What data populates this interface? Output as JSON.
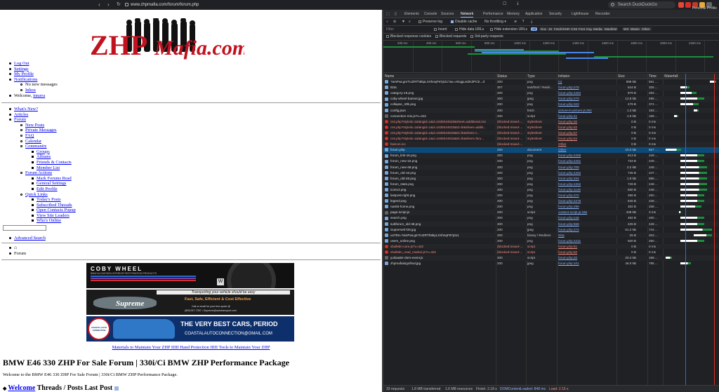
{
  "browser": {
    "url": "www.zhpmafia.com/forum/forum.php",
    "search_placeholder": "Search DuckDuckGo",
    "profile_label": "Personal Profile",
    "badges": [
      "9",
      "289",
      "17"
    ]
  },
  "page": {
    "logo_text_1": "ZHP",
    "logo_text_2": "Mafia.com",
    "user_menu": {
      "log_out": "Log Out",
      "settings": "Settings",
      "my_profile": "My Profile",
      "notifications": "Notifications",
      "no_new_messages": "No new messages",
      "inbox": "Inbox",
      "welcome_prefix": "Welcome, ",
      "username": "innava"
    },
    "nav": {
      "whats_new": "What's New?",
      "articles": "Articles",
      "forum": "Forum",
      "new_posts": "New Posts",
      "private_messages": "Private Messages",
      "faq": "FAQ",
      "calendar": "Calendar",
      "community": "Community",
      "groups": "Groups",
      "albums": "Albums",
      "friends_contacts": "Friends & Contacts",
      "member_list": "Member List",
      "forum_actions": "Forum Actions",
      "mark_forums_read": "Mark Forums Read",
      "general_settings": "General Settings",
      "edit_profile": "Edit Profile",
      "quick_links": "Quick Links",
      "todays_posts": "Today's Posts",
      "subscribed_threads": "Subscribed Threads",
      "open_contacts_popup": "Open Contacts Popup",
      "view_site_leaders": "View Site Leaders",
      "whos_online": "Who's Online"
    },
    "advanced_search": "Advanced Search",
    "breadcrumb_forum": "Forum",
    "banners": {
      "coby_title": "COBY WHEEL",
      "coby_sub": "BMW ALCANTARA INTERIOR RESTORATION PRODUCTS",
      "supreme_top": "Transporting your vehicle should be easy",
      "supreme_name": "Supreme",
      "supreme_tag": "Fast, Safe, Efficient & Cost Effective",
      "supreme_call": "Call or email for your free quote @",
      "supreme_contact": "(800)787-7357 • Supreme@autotransport.com",
      "coastal_headline": "THE VERY BEST CARS, PERIOD",
      "coastal_email": "COASTALAUTOCONNECTION@GMAIL.COM",
      "coastal_badge": "COASTAL AUTO CONNECTION"
    },
    "materials_link": "Materials to Maintain Your ZHP IIIII Hand Protection IIIII Tools to Maintain Your ZHP",
    "heading": "BMW E46 330 ZHP For Sale Forum | 330i/Ci BMW ZHP Performance Package",
    "description": "Welcome to the BMW E46 330 ZHP For Sale Forum | 330i/Ci BMW ZHP Performance Package.",
    "col_welcome": "Welcome",
    "col_threads": "Threads / Posts",
    "col_last_post": "Last Post"
  },
  "devtools": {
    "tabs": [
      "Elements",
      "Console",
      "Sources",
      "Network",
      "Performance",
      "Memory",
      "Application",
      "Security",
      "Lighthouse",
      "Recorder"
    ],
    "active_tab": "Network",
    "toolbar": {
      "preserve_log": "Preserve log",
      "disable_cache": "Disable cache",
      "throttling": "No throttling"
    },
    "filters": {
      "invert": "Invert",
      "hide_data_urls": "Hide data URLs",
      "hide_extension_urls": "Hide extension URLs",
      "types": [
        "All",
        "Doc",
        "JS",
        "Fetch/XHR",
        "CSS",
        "Font",
        "Img",
        "Media",
        "Manifest",
        "WS",
        "Wasm",
        "Other"
      ],
      "blocked_response_cookies": "Blocked response cookies",
      "blocked_requests": "Blocked requests",
      "third_party_requests": "3rd-party requests"
    },
    "overview_ticks": [
      "200 ms",
      "400 ms",
      "600 ms",
      "800 ms",
      "1000 ms",
      "1200 ms",
      "1400 ms",
      "1600 ms",
      "1800 ms",
      "2000 ms",
      "2200 ms"
    ],
    "columns": [
      "Name",
      "Status",
      "Type",
      "Initiator",
      "Size",
      "Time",
      "Waterfall"
    ],
    "rows": [
      {
        "name": "?amPwLgmTUZRTh8kpLXXhnqF97pt11?ax=AEqgLxIZKZPCE...d",
        "status": "200",
        "type": "png",
        "initiator": "(s)",
        "size": "898 kB",
        "time": "561 ...",
        "icon": "img",
        "wf_start": 0.86,
        "wf_len": 0.12
      },
      {
        "name": "8zta",
        "status": "307",
        "type": "text/html / Redir...",
        "initiator": "forum.php:278",
        "size": "544 B",
        "time": "325 ...",
        "icon": "doc",
        "wf_start": 0.3,
        "wf_len": 0.18
      },
      {
        "name": "category-16.png",
        "status": "200",
        "type": "png",
        "initiator": "forum.php:4284",
        "size": "879 B",
        "time": "293 ...",
        "icon": "img",
        "wf_start": 0.3,
        "wf_len": 0.3
      },
      {
        "name": "coby-wheel-banner.jpg",
        "status": "200",
        "type": "jpeg",
        "initiator": "forum.php:270",
        "size": "12.8 kB",
        "time": "495 ...",
        "icon": "img",
        "wf_start": 0.3,
        "wf_len": 0.45
      },
      {
        "name": "collapse_40b.png",
        "status": "200",
        "type": "png",
        "initiator": "forum.php:323",
        "size": "479 B",
        "time": "374 ...",
        "icon": "img",
        "wf_start": 0.3,
        "wf_len": 0.35
      },
      {
        "name": "config.json",
        "status": "200",
        "type": "fetch",
        "initiator": "picture-in-picture.js:262",
        "size": "1.3 kB",
        "time": "193 ...",
        "icon": "doc",
        "wf_start": 0.55,
        "wf_len": 0.1
      },
      {
        "name": "connection-min.js?v=422",
        "status": "200",
        "type": "script",
        "initiator": "forum.php:41",
        "size": "4.6 kB",
        "time": "168 ...",
        "icon": "js",
        "wf_start": 0.18,
        "wf_len": 0.08
      },
      {
        "name": "css.php?styleid=1&langid=1&d=1639244633&sheet=additional.css",
        "status": "(blocked:mixed-...",
        "type": "stylesheet",
        "initiator": "forum.php:30",
        "size": "0 B",
        "time": "0 ms",
        "icon": "err",
        "wf_start": 0,
        "wf_len": 0
      },
      {
        "name": "css.php?styleid=1&langid=1&d=1639244633&td=ltr&sheet=additi...",
        "status": "(blocked:mixed-...",
        "type": "stylesheet",
        "initiator": "forum.php:82",
        "size": "0 B",
        "time": "0 ms",
        "icon": "err",
        "wf_start": 0,
        "wf_len": 0
      },
      {
        "name": "css.php?styleid=1&langid=1&d=1639244633&td=ltr&sheet=t...",
        "status": "(blocked:mixed-...",
        "type": "stylesheet",
        "initiator": "forum.php:57",
        "size": "0 B",
        "time": "0 ms",
        "icon": "err",
        "wf_start": 0,
        "wf_len": 0
      },
      {
        "name": "css.php?styleid=1&langid=1&d=1639244633&td=ltr&sheet=foru...",
        "status": "(blocked:mixed-...",
        "type": "stylesheet",
        "initiator": "forum.php:84",
        "size": "0 B",
        "time": "0 ms",
        "icon": "err",
        "wf_start": 0,
        "wf_len": 0
      },
      {
        "name": "favicon.ico",
        "status": "(blocked:mixed-...",
        "type": "",
        "initiator": "Other",
        "size": "0 B",
        "time": "0 ms",
        "icon": "err",
        "wf_start": 0,
        "wf_len": 0
      },
      {
        "name": "forum.php",
        "status": "200",
        "type": "document",
        "initiator": "Other",
        "size": "20.0 kB",
        "time": "657 ...",
        "icon": "doc",
        "wf_start": 0.02,
        "wf_len": 0.3,
        "selected": true
      },
      {
        "name": "forum_link-16.png",
        "status": "200",
        "type": "png",
        "initiator": "forum.php:4285",
        "size": "813 B",
        "time": "248 ...",
        "icon": "img",
        "wf_start": 0.3,
        "wf_len": 0.45
      },
      {
        "name": "forum_new-16.png",
        "status": "200",
        "type": "png",
        "initiator": "forum.php:4281",
        "size": "733 B",
        "time": "249 ...",
        "icon": "img",
        "wf_start": 0.3,
        "wf_len": 0.45
      },
      {
        "name": "forum_new-48.png",
        "status": "200",
        "type": "png",
        "initiator": "forum.php:709",
        "size": "2.2 kB",
        "time": "248 ...",
        "icon": "img",
        "wf_start": 0.3,
        "wf_len": 0.5
      },
      {
        "name": "forum_old-16.png",
        "status": "200",
        "type": "png",
        "initiator": "forum.php:4282",
        "size": "745 B",
        "time": "247 ...",
        "icon": "img",
        "wf_start": 0.3,
        "wf_len": 0.5
      },
      {
        "name": "forum_old-48.png",
        "status": "200",
        "type": "png",
        "initiator": "forum.php:334",
        "size": "1.9 kB",
        "time": "586 ...",
        "icon": "img",
        "wf_start": 0.3,
        "wf_len": 0.5
      },
      {
        "name": "forum_stats.png",
        "status": "200",
        "type": "png",
        "initiator": "forum.php:4262",
        "size": "729 B",
        "time": "248 ...",
        "icon": "img",
        "wf_start": 0.3,
        "wf_len": 0.5
      },
      {
        "name": "icon14.png",
        "status": "200",
        "type": "png",
        "initiator": "forum.php:1149",
        "size": "830 B",
        "time": "248 ...",
        "icon": "img",
        "wf_start": 0.3,
        "wf_len": 0.5
      },
      {
        "name": "lastpost-right.png",
        "status": "200",
        "type": "png",
        "initiator": "forum.php:370",
        "size": "486 B",
        "time": "250 ...",
        "icon": "img",
        "wf_start": 0.3,
        "wf_len": 0.45
      },
      {
        "name": "legend.png",
        "status": "200",
        "type": "png",
        "initiator": "forum.php:4278",
        "size": "645 B",
        "time": "248 ...",
        "icon": "img",
        "wf_start": 0.3,
        "wf_len": 0.45
      },
      {
        "name": "navbit-home.png",
        "status": "200",
        "type": "png",
        "initiator": "forum.php:298",
        "size": "482 B",
        "time": "338 ...",
        "icon": "img",
        "wf_start": 0.3,
        "wf_len": 0.4
      },
      {
        "name": "page-script.js",
        "status": "200",
        "type": "script",
        "initiator": "content-script.js:186",
        "size": "438 kB",
        "time": "3 ms",
        "icon": "js",
        "wf_start": 0.28,
        "wf_len": 0.03
      },
      {
        "name": "search.png",
        "status": "200",
        "type": "png",
        "initiator": "forum.php:246",
        "size": "482 B",
        "time": "460 ...",
        "icon": "img",
        "wf_start": 0.3,
        "wf_len": 0.45
      },
      {
        "name": "subforum_old-48.png",
        "status": "200",
        "type": "png",
        "initiator": "forum.php:568",
        "size": "425 B",
        "time": "248 ...",
        "icon": "img",
        "wf_start": 0.3,
        "wf_len": 0.45
      },
      {
        "name": "Supreme0728.jpg",
        "status": "200",
        "type": "jpeg",
        "initiator": "forum.php:274",
        "size": "61.2 kB",
        "time": "744 ...",
        "icon": "img",
        "wf_start": 0.3,
        "wf_len": 0.6
      },
      {
        "name": "uoTk9=?amPwLgmTUZRTh8kpLXXhnqF97pt11",
        "status": "200",
        "type": "binary / Redirect",
        "initiator": "8zta",
        "size": "25 B",
        "time": "453 ...",
        "icon": "doc",
        "wf_start": 0.55,
        "wf_len": 0.35
      },
      {
        "name": "users_online.png",
        "status": "200",
        "type": "png",
        "initiator": "forum.php:4231",
        "size": "920 B",
        "time": "250 ...",
        "icon": "img",
        "wf_start": 0.3,
        "wf_len": 0.45
      },
      {
        "name": "vbulletin-core.js?v=422",
        "status": "(blocked:mixed-...",
        "type": "script",
        "initiator": "forum.php:51",
        "size": "0 B",
        "time": "0 ms",
        "icon": "err",
        "wf_start": 0,
        "wf_len": 0
      },
      {
        "name": "vbulletin_read_marker.js?v=422",
        "status": "(blocked:mixed-...",
        "type": "script",
        "initiator": "forum.php:82",
        "size": "0 B",
        "time": "0 ms",
        "icon": "err",
        "wf_start": 0,
        "wf_len": 0
      },
      {
        "name": "yuiloader-dom-event.js",
        "status": "200",
        "type": "script",
        "initiator": "forum.php:20",
        "size": "20.4 kB",
        "time": "198 ...",
        "icon": "js",
        "wf_start": 0.02,
        "wf_len": 0.12
      },
      {
        "name": "zhpmafialogofinal.jpg",
        "status": "200",
        "type": "jpeg",
        "initiator": "forum.php:101",
        "size": "46.0 kB",
        "time": "795 ...",
        "icon": "img",
        "wf_start": 0.3,
        "wf_len": 0.2
      }
    ],
    "status_bar": {
      "requests": "33 requests",
      "transferred": "1.8 MB transferred",
      "resources": "1.6 MB resources",
      "finish": "Finish: 2.18 s",
      "dcl": "DOMContentLoaded: 848 ms",
      "load": "Load: 2.15 s"
    },
    "colors": {
      "accent": "#8ab4f8",
      "error": "#f28b82",
      "dcl_line": "#1a73e8",
      "load_line": "#d93025"
    }
  }
}
